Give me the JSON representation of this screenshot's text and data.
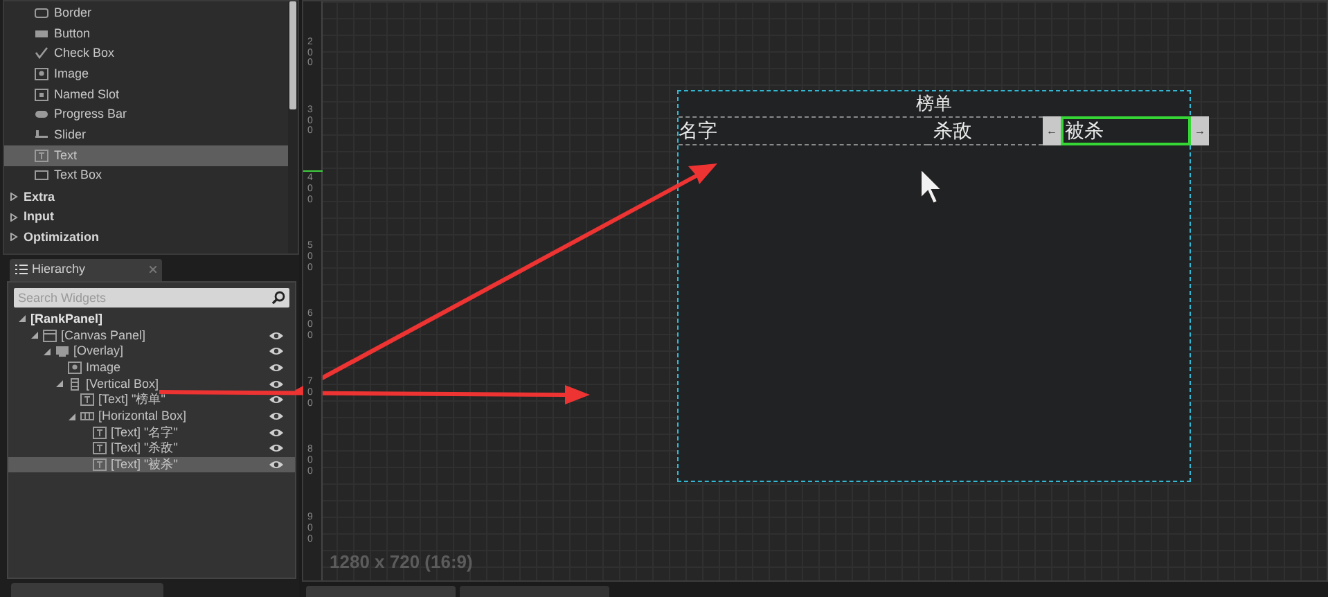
{
  "palette": {
    "items": [
      {
        "label": "Border",
        "kind": "border",
        "selected": false
      },
      {
        "label": "Button",
        "kind": "button",
        "selected": false
      },
      {
        "label": "Check Box",
        "kind": "checkbox",
        "selected": false
      },
      {
        "label": "Image",
        "kind": "image",
        "selected": false
      },
      {
        "label": "Named Slot",
        "kind": "slot",
        "selected": false
      },
      {
        "label": "Progress Bar",
        "kind": "progress",
        "selected": false
      },
      {
        "label": "Slider",
        "kind": "slider",
        "selected": false
      },
      {
        "label": "Text",
        "kind": "text",
        "selected": true
      },
      {
        "label": "Text Box",
        "kind": "textbox",
        "selected": false
      }
    ],
    "categories": [
      {
        "label": "Extra",
        "expanded": false
      },
      {
        "label": "Input",
        "expanded": false
      },
      {
        "label": "Optimization",
        "expanded": false
      }
    ]
  },
  "hierarchy": {
    "tab": "Hierarchy",
    "search": {
      "placeholder": "Search Widgets"
    },
    "tree": [
      {
        "label": "[RankPanel]",
        "kind": "root",
        "selected": false,
        "expanded": true,
        "children": [
          {
            "label": "[Canvas Panel]",
            "kind": "canvas",
            "selected": false,
            "expanded": true,
            "children": [
              {
                "label": "[Overlay]",
                "kind": "overlay",
                "selected": false,
                "expanded": true,
                "children": [
                  {
                    "label": "Image",
                    "kind": "image",
                    "selected": false
                  },
                  {
                    "label": "[Vertical Box]",
                    "kind": "vbox",
                    "selected": false,
                    "expanded": true,
                    "children": [
                      {
                        "label": "[Text] \"榜单\"",
                        "kind": "text",
                        "selected": false
                      },
                      {
                        "label": "[Horizontal Box]",
                        "kind": "hbox",
                        "selected": false,
                        "expanded": true,
                        "children": [
                          {
                            "label": "[Text] \"名字\"",
                            "kind": "text",
                            "selected": false
                          },
                          {
                            "label": "[Text] \"杀敌\"",
                            "kind": "text",
                            "selected": false
                          },
                          {
                            "label": "[Text] \"被杀\"",
                            "kind": "text",
                            "selected": true
                          }
                        ]
                      }
                    ]
                  }
                ]
              }
            ]
          }
        ]
      }
    ]
  },
  "viewport": {
    "ruler": [
      "200",
      "300",
      "400",
      "500",
      "600",
      "700",
      "800",
      "900"
    ],
    "resolution": "1280 x 720 (16:9)",
    "widget": {
      "title": "榜单",
      "columns": [
        {
          "label": "名字",
          "selected": false
        },
        {
          "label": "杀敌",
          "selected": false
        },
        {
          "label": "被杀",
          "selected": true
        }
      ],
      "arrow_left": "←",
      "arrow_right": "→"
    }
  }
}
